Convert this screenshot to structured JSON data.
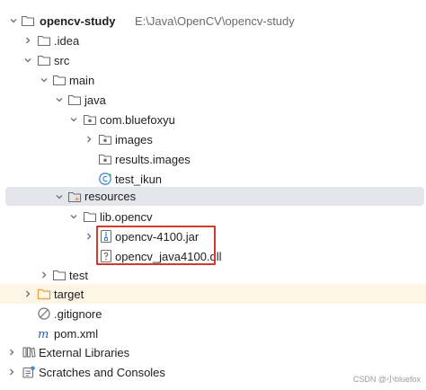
{
  "project": {
    "name": "opencv-study",
    "path": "E:\\Java\\OpenCV\\opencv-study"
  },
  "tree": {
    "idea": ".idea",
    "src": "src",
    "main": "main",
    "java": "java",
    "package": "com.bluefoxyu",
    "images": "images",
    "results_images": "results.images",
    "test_ikun": "test_ikun",
    "resources": "resources",
    "lib_opencv": "lib.opencv",
    "opencv_jar": "opencv-4100.jar",
    "opencv_dll": "opencv_java4100.dll",
    "test": "test",
    "target": "target",
    "gitignore": ".gitignore",
    "pom": "pom.xml",
    "external_libraries": "External Libraries",
    "scratches": "Scratches and Consoles"
  },
  "watermark": "CSDN @小bluefox",
  "colors": {
    "folder": "#6e6e6e",
    "selection": "#e4e6eb",
    "excluded_bg": "#fdf5e6",
    "target_folder": "#e3a23a",
    "highlight_box": "#d23a2e",
    "class_icon": "#3f8bd6"
  }
}
